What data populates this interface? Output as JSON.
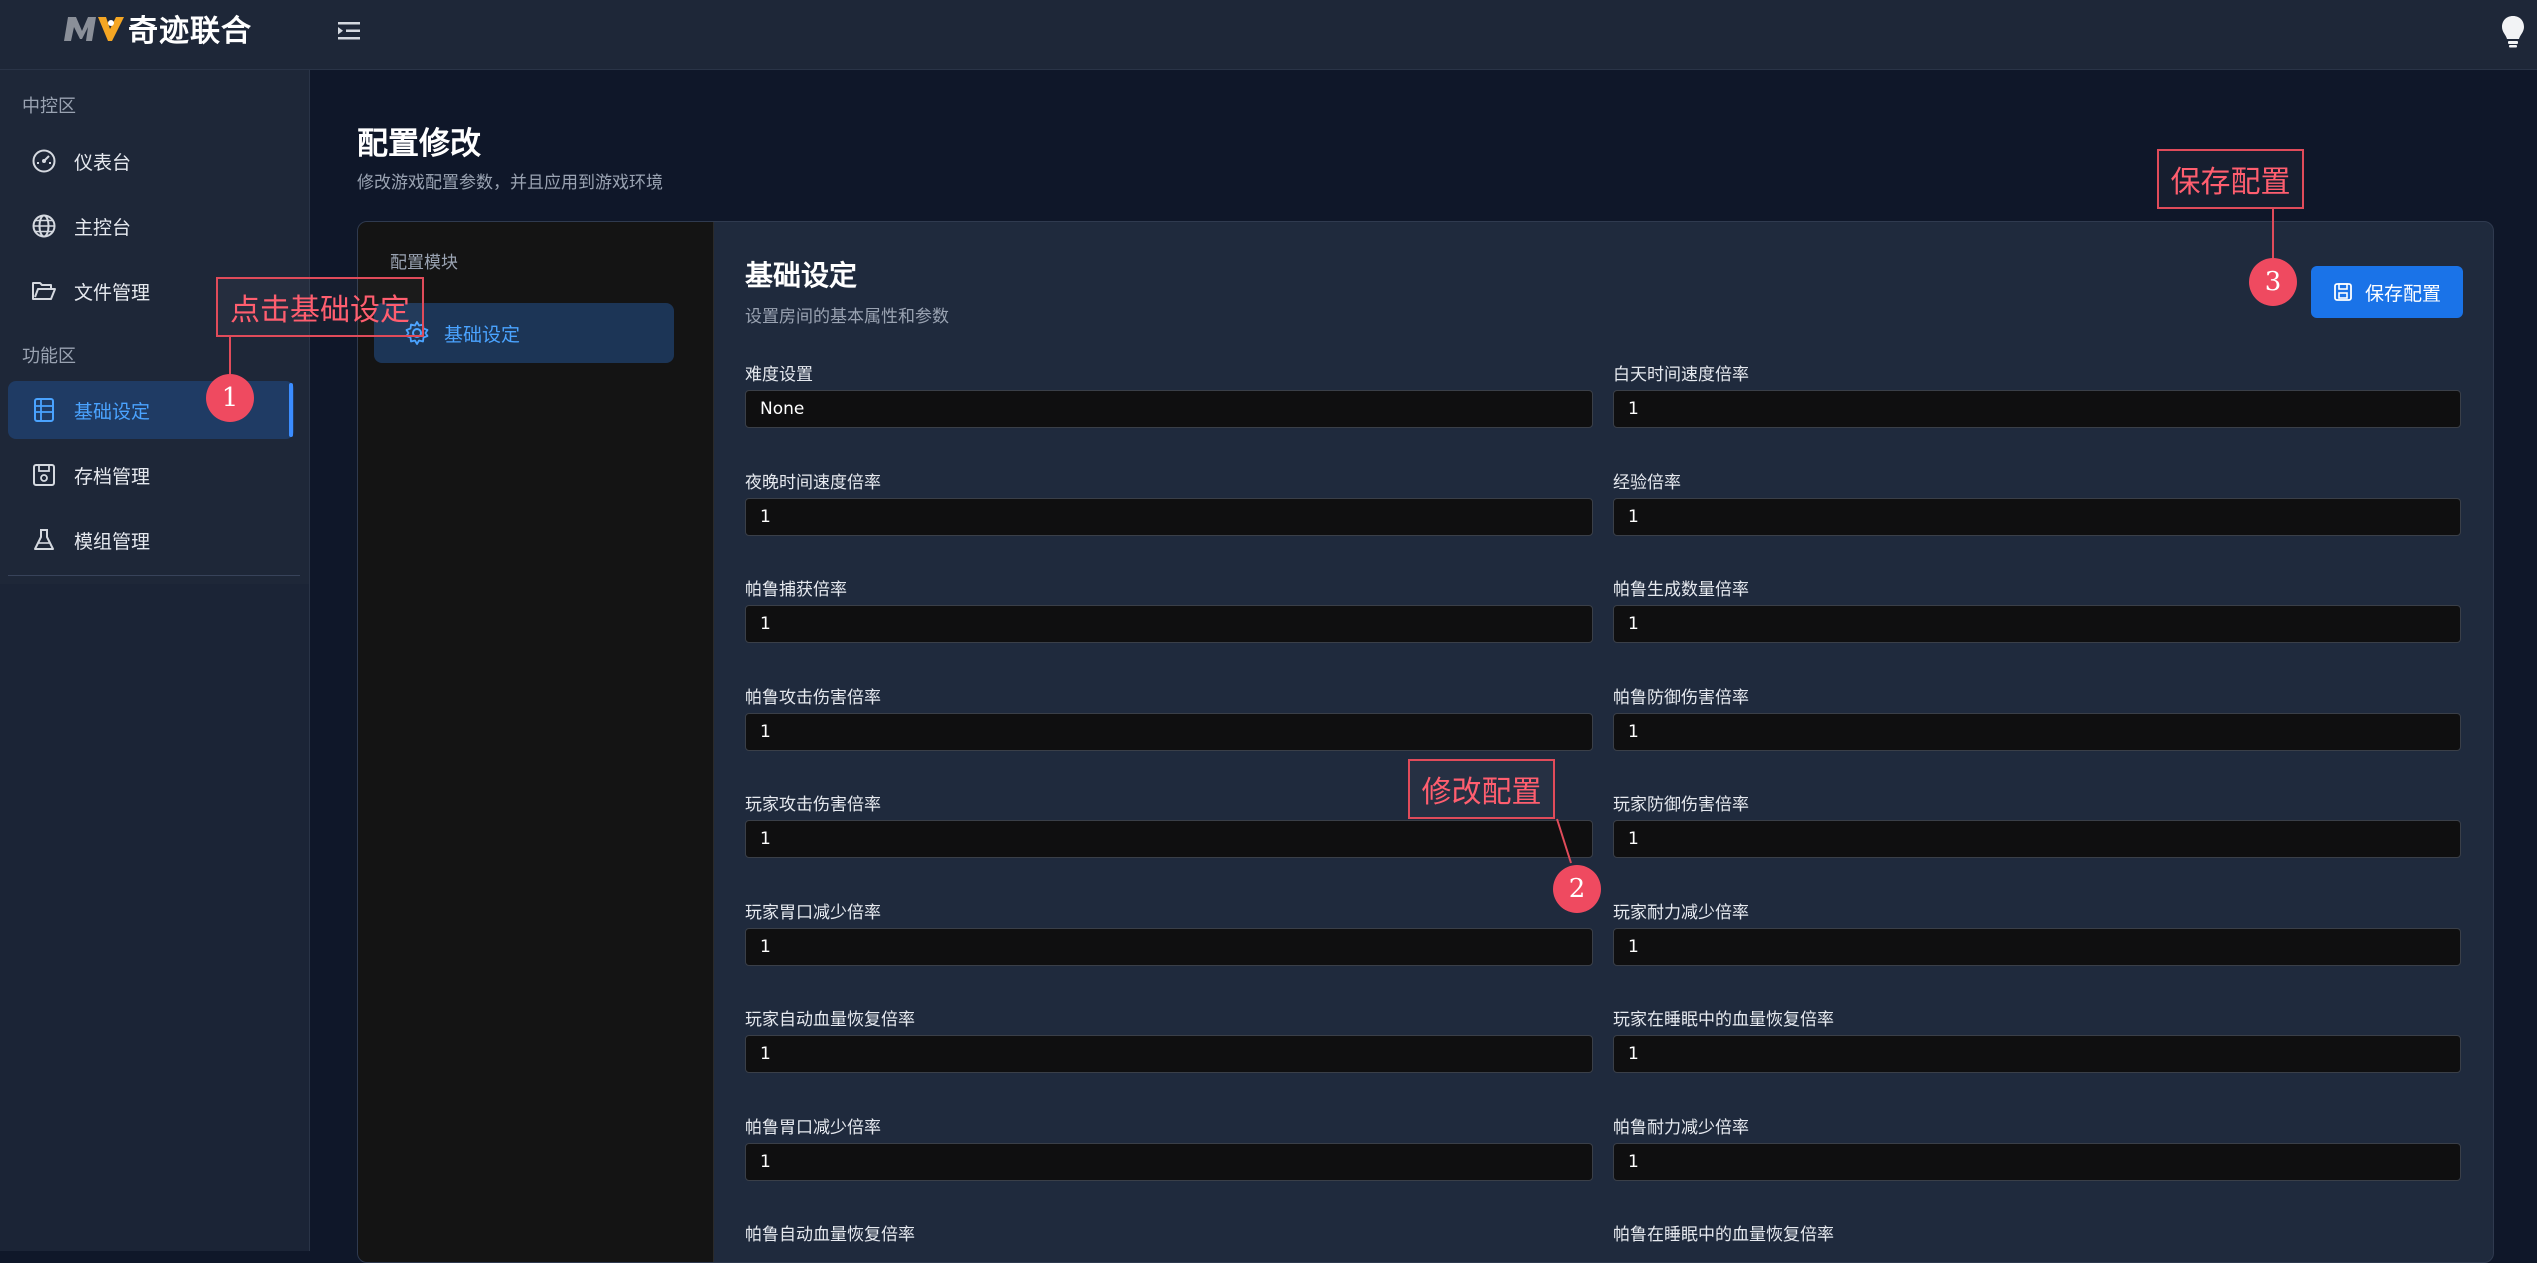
{
  "app": {
    "logo_text": "奇迹联合"
  },
  "sidebar": {
    "sections": [
      {
        "title": "中控区",
        "items": [
          {
            "label": "仪表台",
            "icon": "gauge-icon"
          },
          {
            "label": "主控台",
            "icon": "globe-icon"
          },
          {
            "label": "文件管理",
            "icon": "folder-open-icon"
          }
        ]
      },
      {
        "title": "功能区",
        "items": [
          {
            "label": "基础设定",
            "icon": "list-panel-icon",
            "active": true
          },
          {
            "label": "存档管理",
            "icon": "save-disk-icon"
          },
          {
            "label": "模组管理",
            "icon": "flask-icon"
          }
        ]
      }
    ]
  },
  "page": {
    "title": "配置修改",
    "subtitle": "修改游戏配置参数，并且应用到游戏环境"
  },
  "module_panel": {
    "label": "配置模块",
    "items": [
      {
        "label": "基础设定",
        "icon": "gear-icon",
        "active": true
      }
    ]
  },
  "section": {
    "title": "基础设定",
    "description": "设置房间的基本属性和参数",
    "save_label": "保存配置"
  },
  "fields": [
    {
      "label": "难度设置",
      "value": "None"
    },
    {
      "label": "白天时间速度倍率",
      "value": "1"
    },
    {
      "label": "夜晚时间速度倍率",
      "value": "1"
    },
    {
      "label": "经验倍率",
      "value": "1"
    },
    {
      "label": "帕鲁捕获倍率",
      "value": "1"
    },
    {
      "label": "帕鲁生成数量倍率",
      "value": "1"
    },
    {
      "label": "帕鲁攻击伤害倍率",
      "value": "1"
    },
    {
      "label": "帕鲁防御伤害倍率",
      "value": "1"
    },
    {
      "label": "玩家攻击伤害倍率",
      "value": "1"
    },
    {
      "label": "玩家防御伤害倍率",
      "value": "1"
    },
    {
      "label": "玩家胃口减少倍率",
      "value": "1"
    },
    {
      "label": "玩家耐力减少倍率",
      "value": "1"
    },
    {
      "label": "玩家自动血量恢复倍率",
      "value": "1"
    },
    {
      "label": "玩家在睡眠中的血量恢复倍率",
      "value": "1"
    },
    {
      "label": "帕鲁胃口减少倍率",
      "value": "1"
    },
    {
      "label": "帕鲁耐力减少倍率",
      "value": "1"
    },
    {
      "label": "帕鲁自动血量恢复倍率",
      "value": ""
    },
    {
      "label": "帕鲁在睡眠中的血量恢复倍率",
      "value": ""
    }
  ],
  "annotations": [
    {
      "text": "点击基础设定",
      "number": "1"
    },
    {
      "text": "修改配置",
      "number": "2"
    },
    {
      "text": "保存配置",
      "number": "3"
    }
  ],
  "colors": {
    "accent": "#1a73e8",
    "annotation": "#ef4a60",
    "active_text": "#4aa3ff"
  }
}
